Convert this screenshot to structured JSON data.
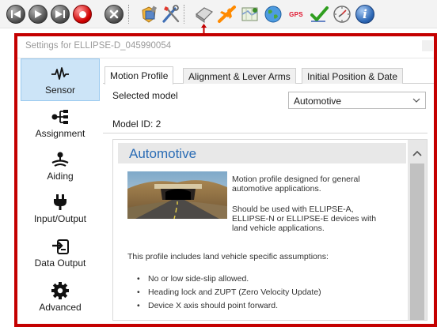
{
  "toolbar": {
    "buttons": [
      {
        "name": "skip-back-icon"
      },
      {
        "name": "play-icon"
      },
      {
        "name": "skip-forward-icon"
      },
      {
        "name": "record-icon"
      },
      {
        "name": "close-circle-icon"
      },
      {
        "name": "shield-settings-icon"
      },
      {
        "name": "tools-icon"
      },
      {
        "name": "ellipse-device-icon"
      },
      {
        "name": "airplane-icon"
      },
      {
        "name": "map-icon"
      },
      {
        "name": "globe-icon"
      },
      {
        "name": "gps-icon",
        "label": "GPS"
      },
      {
        "name": "checkmark-icon"
      },
      {
        "name": "compass-icon"
      },
      {
        "name": "info-icon"
      }
    ]
  },
  "dialog": {
    "title": "Settings for ELLIPSE-D_045990054"
  },
  "nav": {
    "items": [
      {
        "label": "Sensor",
        "icon": "sensor-icon",
        "active": true
      },
      {
        "label": "Assignment",
        "icon": "assignment-icon",
        "active": false
      },
      {
        "label": "Aiding",
        "icon": "aiding-icon",
        "active": false
      },
      {
        "label": "Input/Output",
        "icon": "plug-icon",
        "active": false
      },
      {
        "label": "Data Output",
        "icon": "data-output-icon",
        "active": false
      },
      {
        "label": "Advanced",
        "icon": "gear-icon",
        "active": false
      }
    ]
  },
  "tabs": [
    {
      "label": "Motion Profile",
      "active": true
    },
    {
      "label": "Alignment & Lever Arms",
      "active": false
    },
    {
      "label": "Initial Position & Date",
      "active": false
    }
  ],
  "motion_profile": {
    "selected_model_label": "Selected model",
    "selected_model_value": "Automotive",
    "model_id": "Model ID: 2",
    "panel_title": "Automotive",
    "description_lines": [
      "Motion profile designed for general",
      "automotive applications."
    ],
    "usage_lines": [
      "Should be used with ELLIPSE-A,",
      "ELLIPSE-N or ELLIPSE-E devices with",
      "land vehicle applications."
    ],
    "assumptions_intro": "This profile includes land vehicle specific assumptions:",
    "assumptions": [
      "No or low side-slip allowed.",
      "Heading lock and ZUPT (Zero Velocity Update)",
      "Device X axis should point forward."
    ]
  },
  "colors": {
    "highlight": "#c40000",
    "accent_title": "#2a6cb5",
    "nav_active_bg": "#cce4f7"
  }
}
